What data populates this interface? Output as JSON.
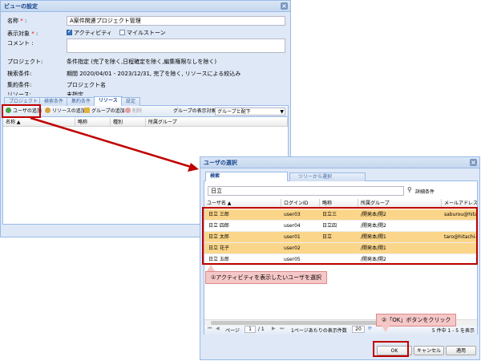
{
  "view_window": {
    "title": "ビューの設定",
    "fields": {
      "name_label": "名称",
      "name_value": "A案件関連プロジェクト管理",
      "display_label": "表示対象",
      "activity_label": "アクティビティ",
      "milestone_label": "マイルストーン",
      "comment_label": "コメント",
      "project_label": "プロジェクト:",
      "project_value": "条件指定 (完了を除く,日程確定を除く,編集権限なしを除く)",
      "search_label": "検索条件:",
      "search_value": "期間 2020/04/01 - 2023/12/31, 完了を除く, リソースによる絞込み",
      "aggregate_label": "集約条件:",
      "aggregate_value": "プロジェクト名",
      "resource_label": "リソース:",
      "resource_value": "未指定"
    },
    "tabs": [
      "プロジェクト",
      "検索条件",
      "集約条件",
      "リソース",
      "設定"
    ],
    "active_tab": "リソース",
    "toolbar": {
      "add_user": "ユーザの追加",
      "add_resource": "リソースの追加",
      "add_group": "グループの追加",
      "delete": "削除",
      "group_display_label": "グループの表示対象",
      "group_display_value": "グループと配下"
    },
    "columns": [
      "名称",
      "略称",
      "種別",
      "所属グループ"
    ]
  },
  "user_dialog": {
    "title": "ユーザの選択",
    "tabs": [
      "検索",
      "ツリーから選択"
    ],
    "active_tab": "検索",
    "search_value": "日立",
    "detail_link": "詳細条件",
    "columns": [
      "ユーザ名",
      "ログインID",
      "略称",
      "所属グループ",
      "メールアドレス"
    ],
    "rows": [
      {
        "name": "日立 三郎",
        "login": "user03",
        "abbr": "日立三",
        "group": "/開発本/開2",
        "mail": "saburou@hitach",
        "selected": true
      },
      {
        "name": "日立 四郎",
        "login": "user04",
        "abbr": "日立四",
        "group": "/開発本/開2",
        "mail": "",
        "selected": false
      },
      {
        "name": "日立 太郎",
        "login": "user01",
        "abbr": "日立",
        "group": "/開発本/開1",
        "mail": "taro@hitachi-so",
        "selected": true
      },
      {
        "name": "日立 花子",
        "login": "user02",
        "abbr": "",
        "group": "/開発本/開1",
        "mail": "",
        "selected": true
      },
      {
        "name": "日立 五郎",
        "login": "user05",
        "abbr": "",
        "group": "/開発本/開2",
        "mail": "",
        "selected": false
      }
    ],
    "pager": {
      "page_label": "ページ",
      "page_value": "1",
      "page_total": "/ 1",
      "per_page_label": "1ページあたりの表示件数",
      "per_page_value": "20",
      "summary": "5 件中 1 - 5 を表示"
    },
    "buttons": {
      "ok": "OK",
      "cancel": "キャンセル",
      "apply": "適用"
    }
  },
  "annotations": {
    "callout1": "①アクティビティを表示したいユーザを選択",
    "callout2": "②「OK」ボタンをクリック"
  },
  "colors": {
    "selected_row": "#fbd68a",
    "highlight": "#c00000",
    "callout_bg": "#f6c7c7"
  }
}
